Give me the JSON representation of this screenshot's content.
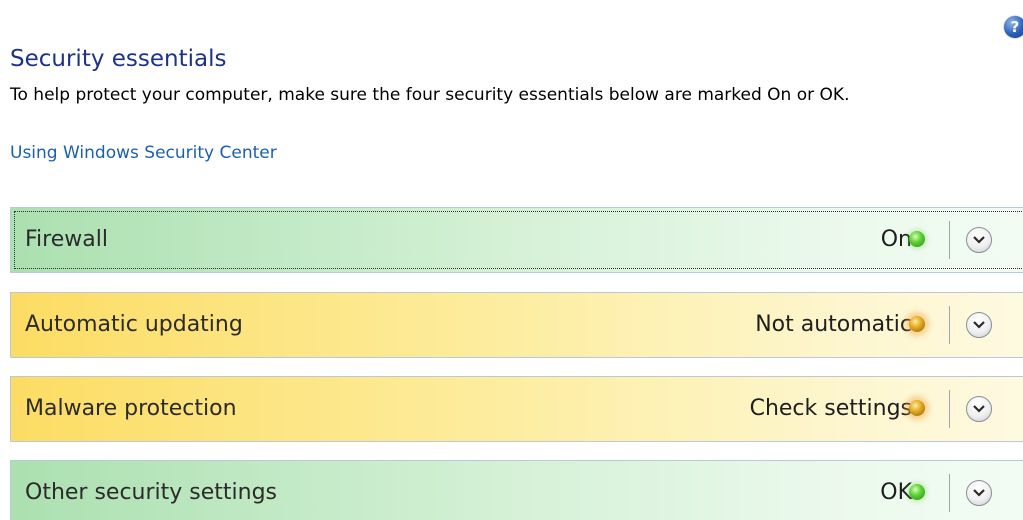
{
  "help": {
    "glyph": "?"
  },
  "header": {
    "title": "Security essentials",
    "description": "To help protect your computer, make sure the four security essentials below are marked On or OK.",
    "link": "Using Windows Security Center"
  },
  "essentials": [
    {
      "label": "Firewall",
      "status": "On",
      "state": "green",
      "indicator_color": "#4cc72a"
    },
    {
      "label": "Automatic updating",
      "status": "Not automatic",
      "state": "yellow",
      "indicator_color": "#e0a320"
    },
    {
      "label": "Malware protection",
      "status": "Check settings",
      "state": "yellow",
      "indicator_color": "#e0a320"
    },
    {
      "label": "Other security settings",
      "status": "OK",
      "state": "green",
      "indicator_color": "#4cc72a"
    }
  ],
  "colors": {
    "title": "#1e3287",
    "link": "#1b5fae",
    "ok_band": "#abe0b0",
    "warn_band": "#fcdc63"
  },
  "icons": {
    "help": "help-icon",
    "expand": "chevron-down-icon",
    "status": "status-light-icon"
  }
}
